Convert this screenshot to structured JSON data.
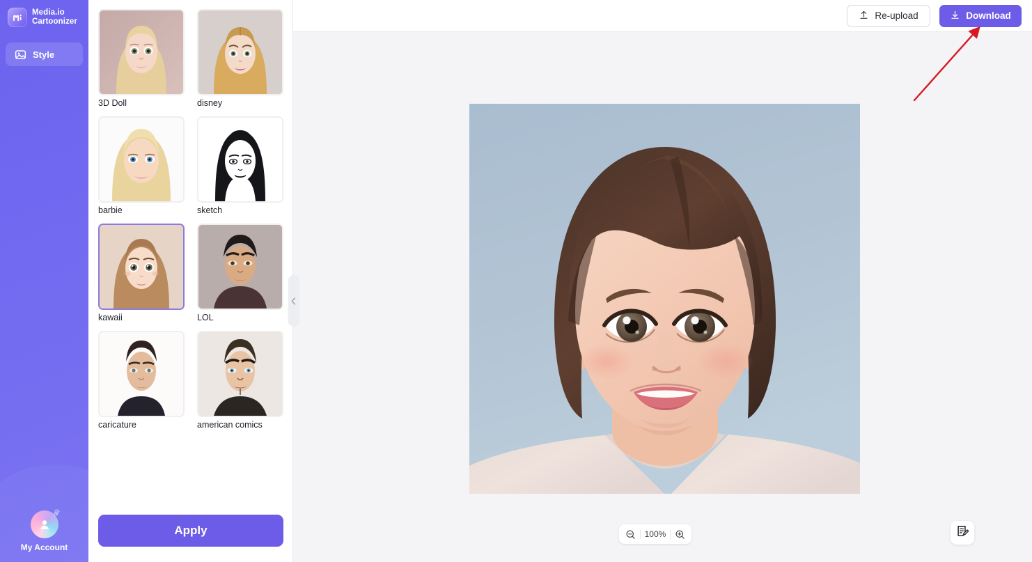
{
  "app": {
    "brand_line1": "Media.io",
    "brand_line2": "Cartoonizer",
    "logo_icon": "media-io-logo-icon"
  },
  "sidebar": {
    "items": [
      {
        "label": "Style",
        "icon": "image-icon",
        "active": true
      }
    ],
    "account": {
      "label": "My Account",
      "avatar_icon": "user-avatar-icon",
      "crown_icon": "crown-icon"
    }
  },
  "toolbar": {
    "reupload_label": "Re-upload",
    "reupload_icon": "upload-icon",
    "download_label": "Download",
    "download_icon": "download-icon",
    "download_color": "#6c5ce7"
  },
  "style_panel": {
    "collapse_icon": "chevron-left-icon",
    "apply_label": "Apply",
    "selected_style": "kawaii",
    "styles": [
      {
        "label": "3D Doll",
        "selected": false
      },
      {
        "label": "disney",
        "selected": false
      },
      {
        "label": "barbie",
        "selected": false
      },
      {
        "label": "sketch",
        "selected": false
      },
      {
        "label": "kawaii",
        "selected": true
      },
      {
        "label": "LOL",
        "selected": false
      },
      {
        "label": "caricature",
        "selected": false
      },
      {
        "label": "american comics",
        "selected": false
      }
    ]
  },
  "canvas": {
    "preview_alt": "cartoonized portrait of a young girl with short brown hair on light blue background",
    "zoom": {
      "level": "100%",
      "zoom_out_icon": "zoom-out-icon",
      "zoom_in_icon": "zoom-in-icon"
    },
    "feedback_icon": "feedback-note-icon"
  },
  "annotation": {
    "arrow_color": "#d71921",
    "arrow_target": "download-button"
  }
}
